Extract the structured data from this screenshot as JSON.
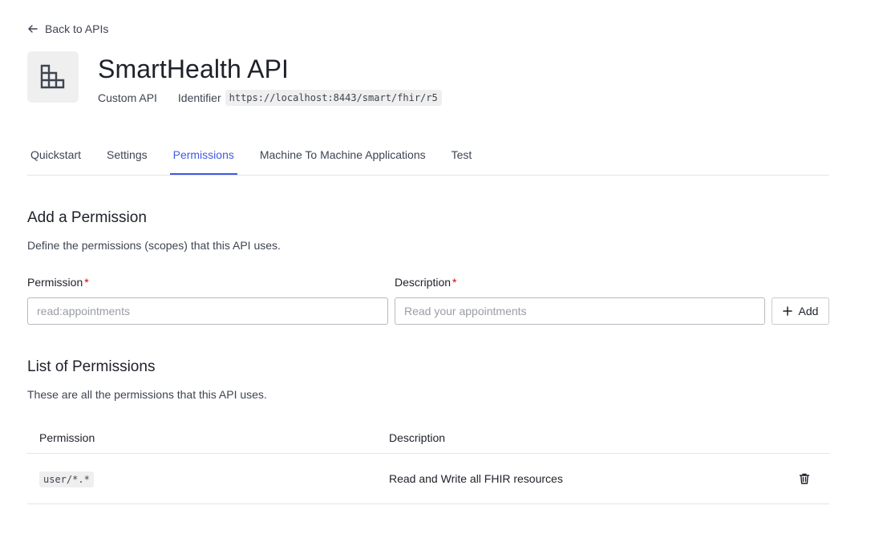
{
  "nav": {
    "back_label": "Back to APIs"
  },
  "api": {
    "name": "SmartHealth API",
    "type": "Custom API",
    "identifier_label": "Identifier",
    "identifier_value": "https://localhost:8443/smart/fhir/r5"
  },
  "tabs": [
    {
      "label": "Quickstart",
      "active": false
    },
    {
      "label": "Settings",
      "active": false
    },
    {
      "label": "Permissions",
      "active": true
    },
    {
      "label": "Machine To Machine Applications",
      "active": false
    },
    {
      "label": "Test",
      "active": false
    }
  ],
  "add_section": {
    "title": "Add a Permission",
    "description": "Define the permissions (scopes) that this API uses.",
    "permission_label": "Permission",
    "permission_placeholder": "read:appointments",
    "permission_value": "",
    "description_label": "Description",
    "description_placeholder": "Read your appointments",
    "description_value": "",
    "required_marker": "*",
    "add_label": "Add"
  },
  "list_section": {
    "title": "List of Permissions",
    "description": "These are all the permissions that this API uses.",
    "columns": [
      "Permission",
      "Description"
    ],
    "rows": [
      {
        "permission": "user/*.*",
        "description": "Read and Write all FHIR resources"
      }
    ]
  },
  "colors": {
    "accent": "#3f59e4",
    "required": "#d0021b",
    "text": "#1e212a",
    "muted": "#3f4452"
  },
  "icons": {
    "back": "arrow-left-icon",
    "logo": "building-blocks-icon",
    "add": "plus-icon",
    "delete": "trash-icon"
  }
}
